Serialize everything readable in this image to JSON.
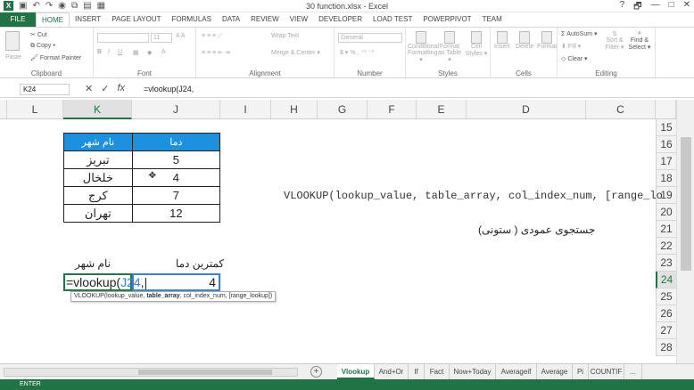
{
  "app": {
    "title": "30 function.xlsx - Excel",
    "logo": "X",
    "window_buttons": [
      "?",
      "🗗",
      "—",
      "□",
      "✕"
    ]
  },
  "ribbon_tabs": [
    "FILE",
    "HOME",
    "INSERT",
    "PAGE LAYOUT",
    "FORMULAS",
    "DATA",
    "REVIEW",
    "VIEW",
    "DEVELOPER",
    "LOAD TEST",
    "POWERPIVOT",
    "TEAM"
  ],
  "ribbon": {
    "clipboard": {
      "label": "Clipboard",
      "paste": "Paste",
      "cut": "Cut",
      "copy": "Copy ▾",
      "format_painter": "Format Painter"
    },
    "font": {
      "label": "Font",
      "font_size": "11"
    },
    "alignment": {
      "label": "Alignment",
      "wrap_text": "Wrap Text",
      "merge_center": "Merge & Center ▾"
    },
    "number": {
      "label": "Number",
      "format": "General"
    },
    "styles": {
      "label": "Styles",
      "conditional": "Conditional Formatting ▾",
      "format_as_table": "Format as Table ▾",
      "cell_styles": "Cell Styles ▾"
    },
    "cells": {
      "label": "Cells",
      "insert": "Insert",
      "delete": "Delete",
      "format": "Format"
    },
    "editing": {
      "label": "Editing",
      "autosum": "AutoSum ▾",
      "fill": "Fill ▾",
      "clear": "Clear ▾",
      "sort_filter": "Sort & Filter ▾",
      "find_select": "Find & Select ▾"
    }
  },
  "formula_bar": {
    "name_box": "K24",
    "cancel": "✕",
    "enter": "✓",
    "fx": "fx",
    "formula": "=vlookup(J24,"
  },
  "columns": [
    "L",
    "K",
    "J",
    "I",
    "H",
    "G",
    "F",
    "E",
    "D",
    "C"
  ],
  "selected_column": "K",
  "rows": [
    "15",
    "16",
    "17",
    "18",
    "19",
    "20",
    "21",
    "22",
    "23",
    "24",
    "25",
    "26",
    "27",
    "28"
  ],
  "selected_row": "24",
  "table": {
    "header_city": "نام شهر",
    "header_temp": "دما",
    "rows": [
      {
        "city": "تبریز",
        "temp": "5"
      },
      {
        "city": "خلخال",
        "temp": "4"
      },
      {
        "city": "کرج",
        "temp": "7"
      },
      {
        "city": "تهران",
        "temp": "12"
      }
    ]
  },
  "labels": {
    "min_temp": "کمترین دما",
    "city_name": "نام شهر",
    "vertical_lookup": "جستجوی عمودی ( ستونی)"
  },
  "syntax_text": "VLOOKUP(lookup_value, table_array, col_index_num, [range_lo",
  "editing_cell": {
    "prefix": "=vlookup(",
    "ref": "J24",
    "suffix": ","
  },
  "value_cell": "4",
  "tooltip": {
    "pre": "VLOOKUP(lookup_value, ",
    "bold": "table_array",
    "post": ", col_index_num, [range_lookup])"
  },
  "sheet_tabs": [
    "Vlookup",
    "And+Or",
    "If",
    "Fact",
    "Now+Today",
    "Averageif",
    "Average",
    "Pi",
    "COUNTIF",
    "..."
  ],
  "active_sheet": "Vlookup",
  "add_sheet": "+",
  "status": "ENTER",
  "colors": {
    "excel_green": "#217346",
    "table_header": "#1e90e0",
    "ref_blue": "#3a7fd5"
  }
}
